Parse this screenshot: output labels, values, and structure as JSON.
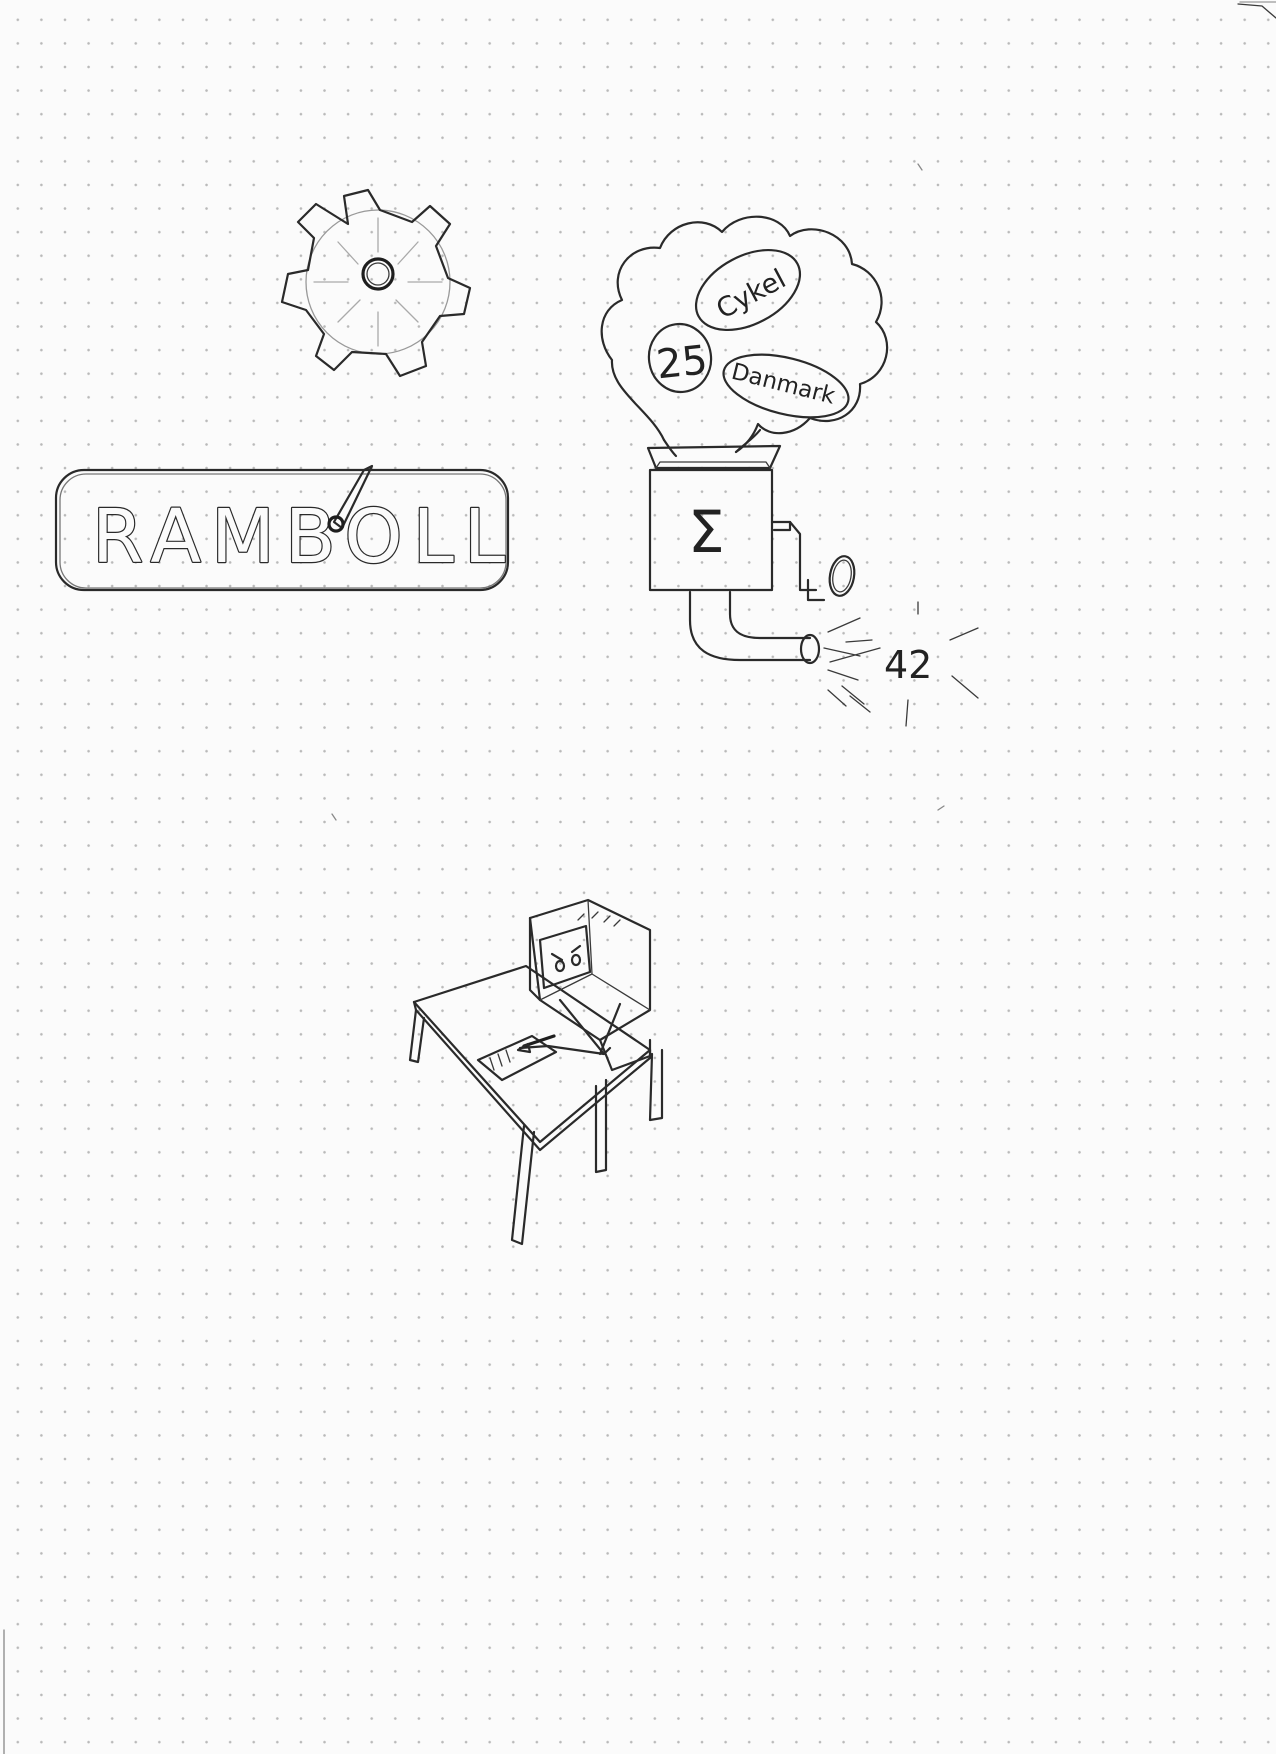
{
  "logo": {
    "text": "RAMBOLL"
  },
  "thought_cloud": {
    "bubble_number": "25",
    "bubble_top": "Cykel",
    "bubble_bottom": "Danmark"
  },
  "machine": {
    "label_symbol": "Σ",
    "output_value": "42"
  },
  "icons": {
    "gear": "gear-icon",
    "computer": "computer-at-desk-icon"
  }
}
